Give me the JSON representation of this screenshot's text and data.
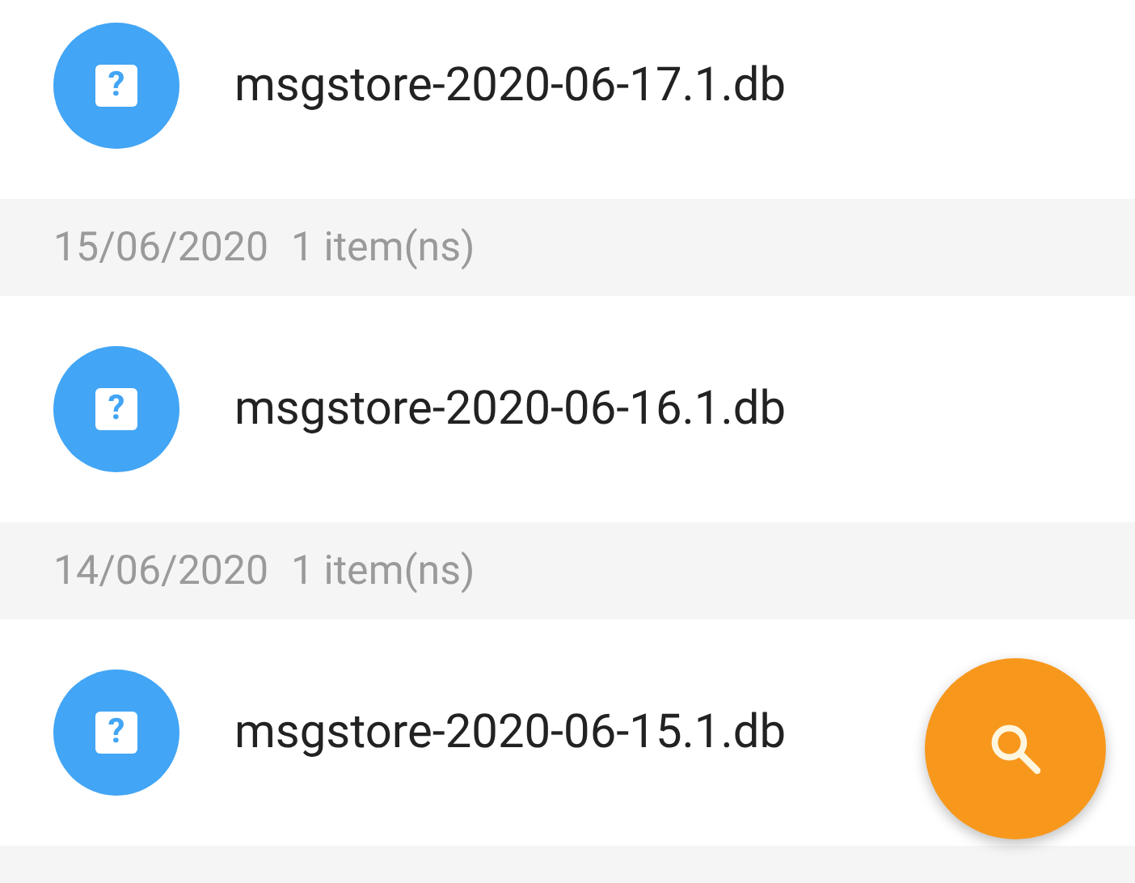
{
  "groups": [
    {
      "files": [
        {
          "icon_glyph": "?",
          "name": "msgstore-2020-06-17.1.db"
        }
      ]
    },
    {
      "header": {
        "kind": "date",
        "date": "15/06/2020",
        "count": "1 item(ns)"
      },
      "files": [
        {
          "icon_glyph": "?",
          "name": "msgstore-2020-06-16.1.db"
        }
      ]
    },
    {
      "header": {
        "kind": "date",
        "date": "14/06/2020",
        "count": "1 item(ns)"
      },
      "files": [
        {
          "icon_glyph": "?",
          "name": "msgstore-2020-06-15.1.db"
        }
      ]
    },
    {
      "header": {
        "kind": "date"
      }
    }
  ],
  "fab": {
    "kind": "search"
  }
}
